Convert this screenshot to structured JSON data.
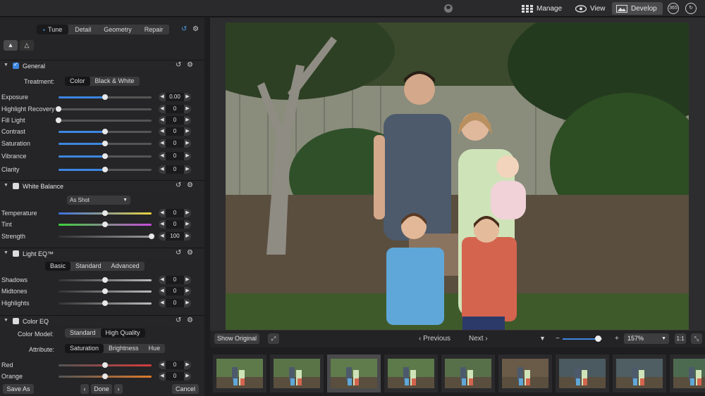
{
  "topbar": {
    "modes": [
      {
        "label": "Manage",
        "icon": "grid-icon"
      },
      {
        "label": "View",
        "icon": "eye-icon"
      },
      {
        "label": "Develop",
        "icon": "develop-icon"
      }
    ],
    "badge_365": "365"
  },
  "panel": {
    "tabs": [
      "Tune",
      "Detail",
      "Geometry",
      "Repair"
    ],
    "selected_tab": "Tune",
    "general": {
      "title": "General",
      "enabled": true,
      "treatment_label": "Treatment:",
      "treatment_options": [
        "Color",
        "Black & White"
      ],
      "treatment_selected": "Color",
      "sliders": [
        {
          "label": "Exposure",
          "value": "0.00",
          "level": 0.5
        },
        {
          "label": "Highlight Recovery",
          "value": "0",
          "level": 0.0
        },
        {
          "label": "Fill Light",
          "value": "0",
          "level": 0.0
        },
        {
          "label": "Contrast",
          "value": "0",
          "level": 0.5
        },
        {
          "label": "Saturation",
          "value": "0",
          "level": 0.5
        },
        {
          "label": "Vibrance",
          "value": "0",
          "level": 0.5
        },
        {
          "label": "Clarity",
          "value": "0",
          "level": 0.5
        }
      ]
    },
    "white_balance": {
      "title": "White Balance",
      "enabled": false,
      "preset": "As Shot",
      "sliders": [
        {
          "label": "Temperature",
          "value": "0",
          "level": 0.5
        },
        {
          "label": "Tint",
          "value": "0",
          "level": 0.5
        },
        {
          "label": "Strength",
          "value": "100",
          "level": 1.0
        }
      ]
    },
    "light_eq": {
      "title": "Light EQ™",
      "enabled": false,
      "modes": [
        "Basic",
        "Standard",
        "Advanced"
      ],
      "mode_selected": "Basic",
      "sliders": [
        {
          "label": "Shadows",
          "value": "0",
          "level": 0.5
        },
        {
          "label": "Midtones",
          "value": "0",
          "level": 0.5
        },
        {
          "label": "Highlights",
          "value": "0",
          "level": 0.5
        }
      ]
    },
    "color_eq": {
      "title": "Color EQ",
      "enabled": false,
      "model_label": "Color Model:",
      "model_options": [
        "Standard",
        "High Quality"
      ],
      "model_selected": "High Quality",
      "attribute_label": "Attribute:",
      "attribute_options": [
        "Saturation",
        "Brightness",
        "Hue"
      ],
      "attribute_selected": "Saturation",
      "sliders": [
        {
          "label": "Red",
          "value": "0",
          "level": 0.5
        },
        {
          "label": "Orange",
          "value": "0",
          "level": 0.5
        }
      ]
    },
    "footer": {
      "save_as": "Save As",
      "done": "Done",
      "cancel": "Cancel"
    }
  },
  "viewer": {
    "show_original": "Show Original",
    "previous": "Previous",
    "next": "Next",
    "zoom": "157%",
    "zoom_level": 0.9,
    "one_to_one": "1:1"
  },
  "filmstrip": {
    "count": 9,
    "selected_index": 2
  },
  "colors": {
    "accent": "#3d86e0",
    "panel_bg": "#252527",
    "temperature_gradient": [
      "#3d6fe0",
      "#e8d23d"
    ],
    "tint_gradient": [
      "#3dd23d",
      "#c84ad8"
    ],
    "red_slider": "#d83a3a",
    "orange_slider": "#e07a2a"
  }
}
